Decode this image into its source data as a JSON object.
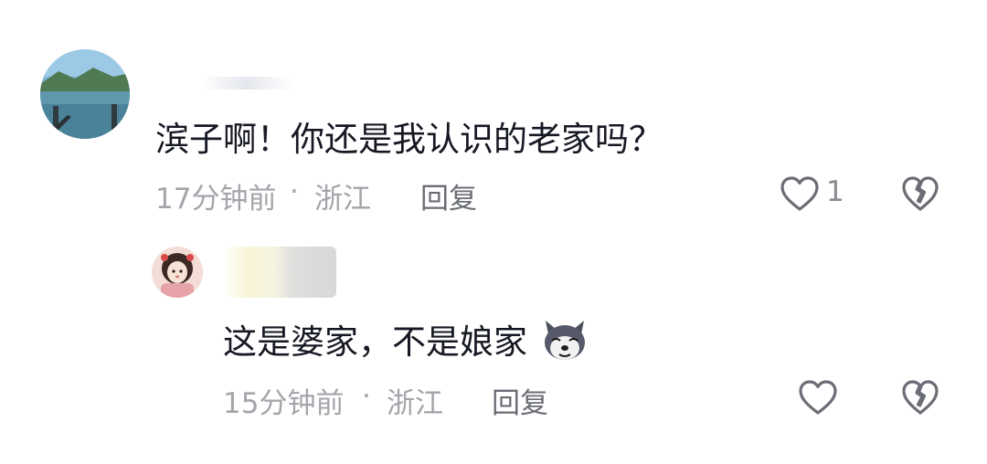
{
  "comments": [
    {
      "content": "滨子啊！你还是我认识的老家吗？",
      "time": "17分钟前",
      "separator": "·",
      "location": "浙江",
      "reply_label": "回复",
      "like_count": "1",
      "avatar_icon": "avatar-seaside-photo"
    },
    {
      "content": "这是婆家，不是娘家",
      "time": "15分钟前",
      "separator": "·",
      "location": "浙江",
      "reply_label": "回复",
      "like_count": "",
      "avatar_icon": "avatar-girl-illustration",
      "emoji_icon": "husky-dog-emoji"
    }
  ],
  "icons": {
    "like": "heart-outline-icon",
    "dislike": "broken-heart-icon"
  },
  "colors": {
    "text_primary": "#161823",
    "text_meta": "#a4a4ab",
    "reply": "#6b6d75",
    "icon": "#6b6d75"
  }
}
